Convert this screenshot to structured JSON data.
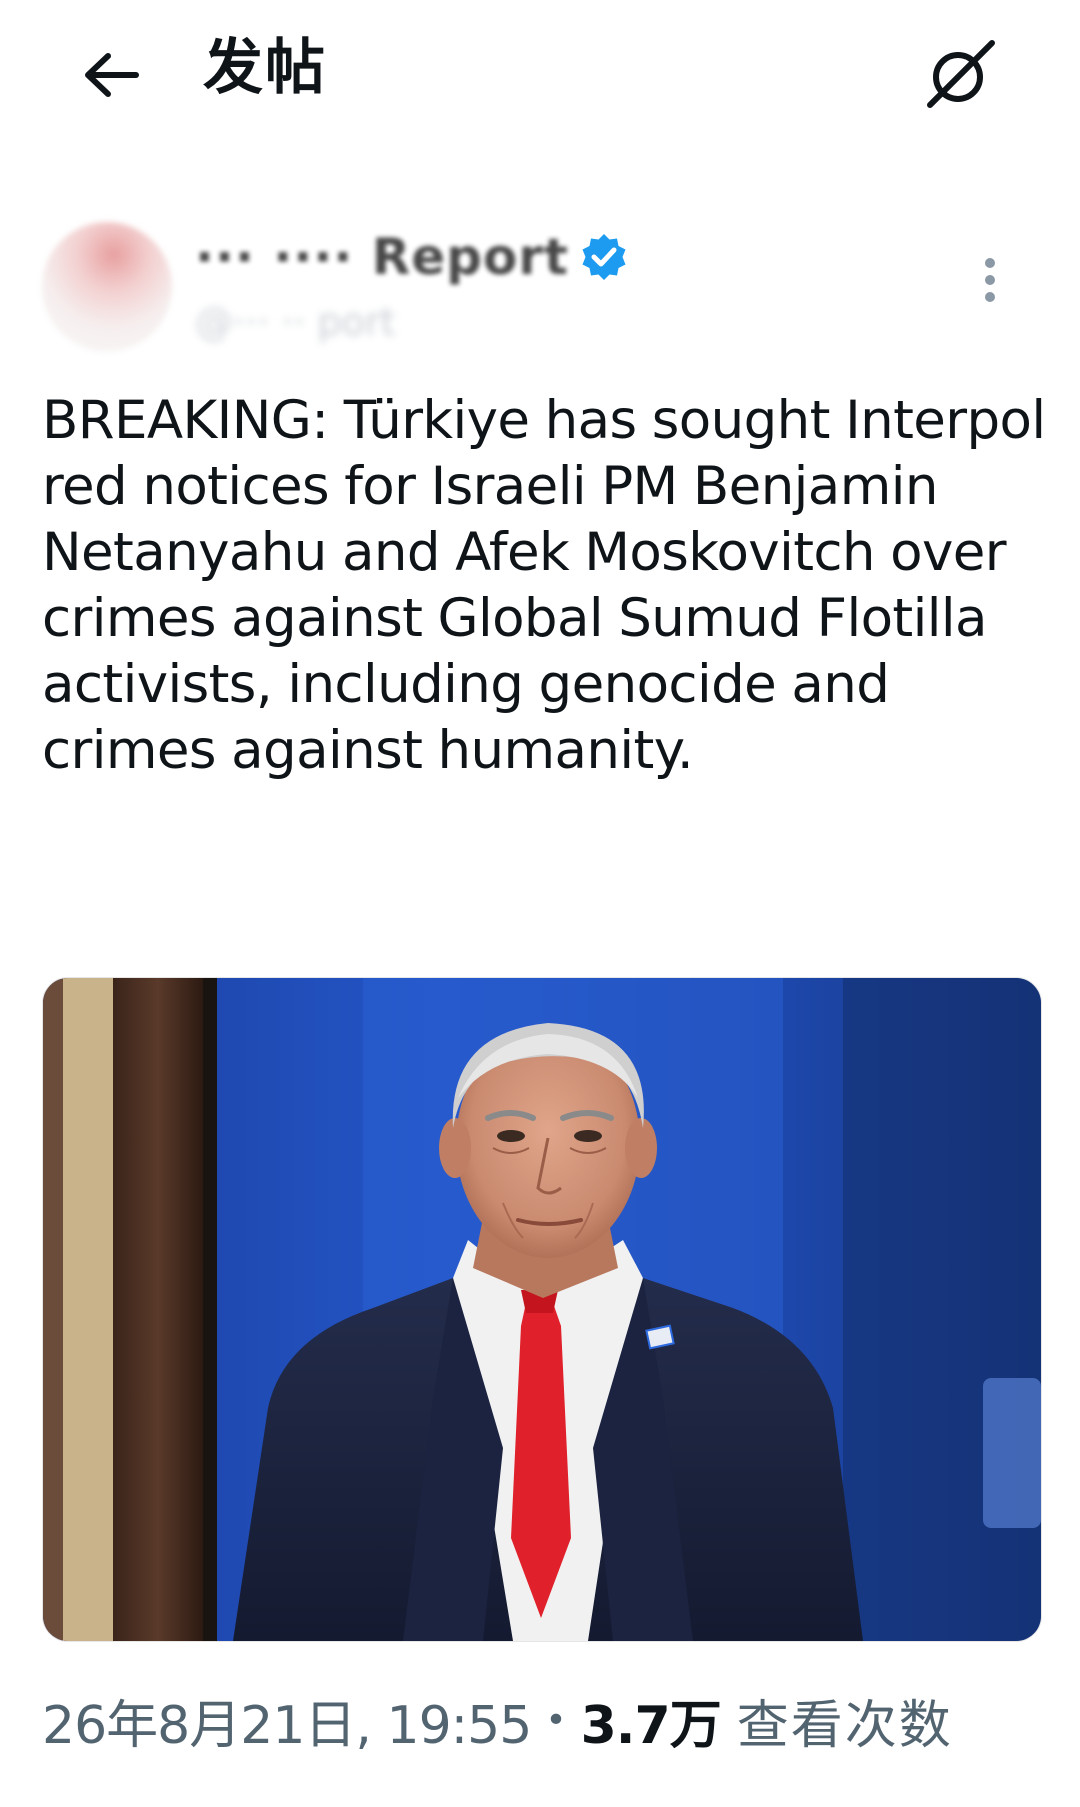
{
  "header": {
    "title": "发帖"
  },
  "author": {
    "display_name": "··· ···· Report",
    "handle": "@··· ·· port",
    "verified": true
  },
  "tweet": {
    "text": "BREAKING: Türkiye has sought Interpol red notices for Israeli PM Benjamin Netanyahu and Afek Moskovitch over crimes against Global Sumud Flotilla activists, including genocide and crimes against humanity."
  },
  "meta": {
    "time": "26年8月21日, 19:55",
    "dot": "•",
    "view_count": "3.7万",
    "views_label": "查看次数"
  },
  "colors": {
    "verified_blue": "#1d9bf0",
    "tie_red": "#e0202a",
    "backdrop_blue": "#1f4fc0",
    "suit_navy": "#1c2541"
  },
  "icons": {
    "back": "arrow-left-icon",
    "grok": "grok-icon",
    "verified": "verified-badge-icon",
    "more": "more-vertical-icon"
  }
}
